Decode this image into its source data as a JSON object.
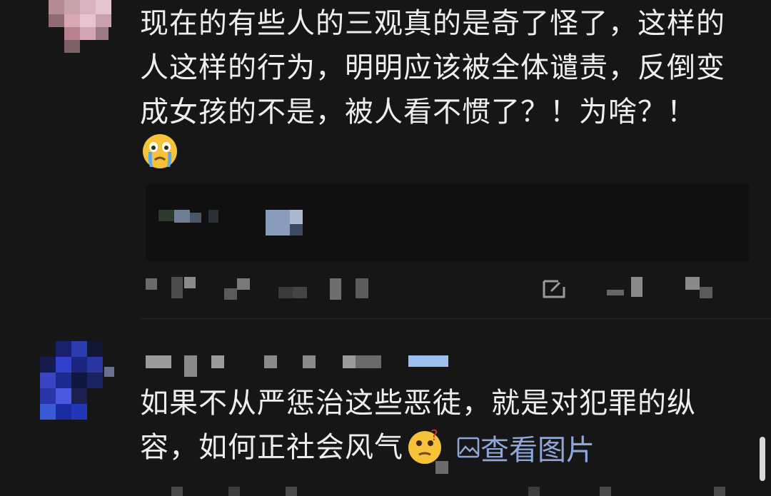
{
  "comment1": {
    "text_line1": "现在的有些人的三观真的是奇了怪了，这样的",
    "text_line2": "人这样的行为，明明应该被全体谴责，反倒变",
    "text_line3": "成女孩的不是，被人看不惯了？！为啥？！",
    "emoji": "crying-face-emoji"
  },
  "comment2": {
    "text_line1": "如果不从严惩治这些恶徒，就是对犯罪的纵",
    "text_line2": "容，如何正社会风气",
    "emoji": "thinking-face-emoji",
    "view_image_label": "查看图片"
  },
  "colors": {
    "background": "#161616",
    "text": "#eeeeee",
    "link": "#8ea6d8"
  }
}
